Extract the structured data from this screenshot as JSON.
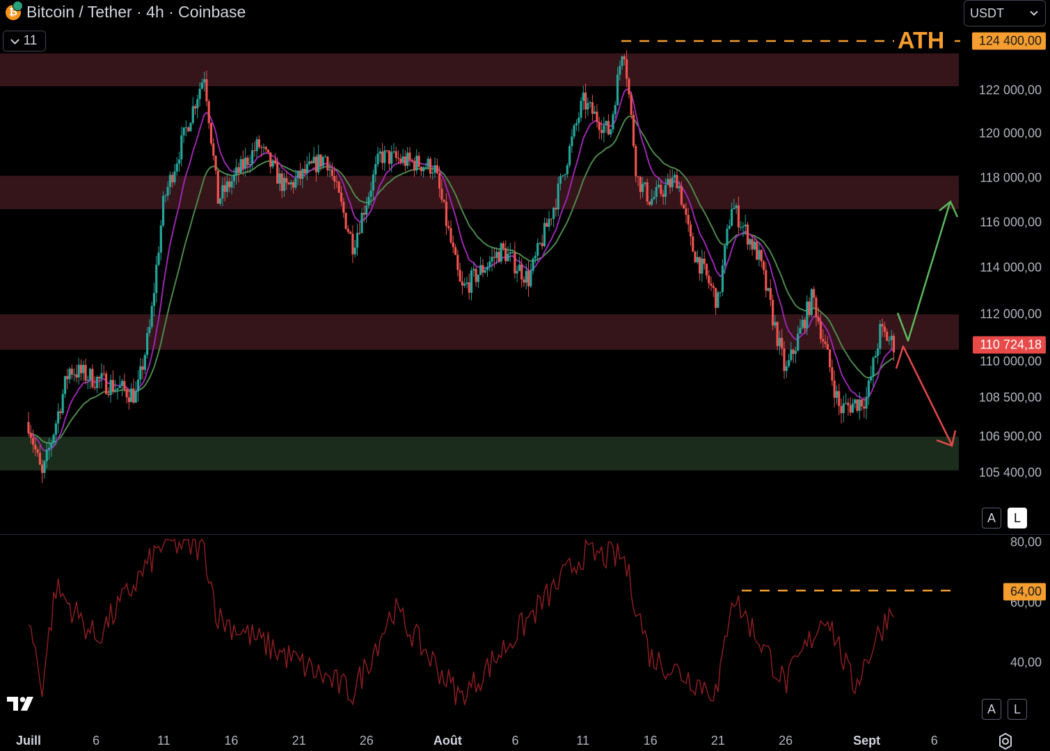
{
  "header": {
    "title": "Bitcoin / Tether · 4h · Coinbase",
    "indicator_count": "11",
    "currency": "USDT"
  },
  "annotations": {
    "ath_label": "ATH",
    "ath_price": "124 400,00",
    "current_price": "110 724,18",
    "rsi_marker": "64,00"
  },
  "price_axis": {
    "labels": [
      "122 000,00",
      "120 000,00",
      "118 000,00",
      "116 000,00",
      "114 000,00",
      "112 000,00",
      "110 000,00",
      "108 500,00",
      "106 900,00",
      "105 400,00"
    ]
  },
  "rsi_axis": {
    "labels": [
      "80,00",
      "60,00",
      "40,00"
    ]
  },
  "time_axis": {
    "labels": [
      "Juill",
      "6",
      "11",
      "16",
      "21",
      "26",
      "Août",
      "6",
      "11",
      "16",
      "21",
      "26",
      "Sept",
      "6"
    ]
  },
  "scale_buttons": {
    "auto": "A",
    "log": "L"
  },
  "colors": {
    "background": "#000000",
    "up_candle": "#26a69a",
    "down_candle": "#ef5350",
    "zone_red": "#35141a",
    "zone_green": "#1b2c1c",
    "ema_fast": "#9c27b0",
    "ema_slow": "#4e8a4e",
    "ath_orange": "#f59d2e",
    "arrow_up": "#5cb85c",
    "arrow_down": "#e84a4a",
    "rsi_line": "#8b1e22"
  },
  "chart_data": {
    "type": "candlestick",
    "title": "Bitcoin / Tether · 4h · Coinbase",
    "y_unit": "USDT",
    "ylim": [
      104500,
      125200
    ],
    "key_points": [
      {
        "x": "Juill 1",
        "price": 107500
      },
      {
        "x": "Juill 2",
        "price": 105200
      },
      {
        "x": "Juill 4",
        "price": 109700
      },
      {
        "x": "Juill 9",
        "price": 108600
      },
      {
        "x": "Juill 10",
        "price": 111500
      },
      {
        "x": "Juill 11",
        "price": 117000
      },
      {
        "x": "Juill 14",
        "price": 122800
      },
      {
        "x": "Juill 15",
        "price": 117000
      },
      {
        "x": "Juill 18",
        "price": 119500
      },
      {
        "x": "Juill 20",
        "price": 117500
      },
      {
        "x": "Juill 23",
        "price": 119000
      },
      {
        "x": "Juill 25",
        "price": 115000
      },
      {
        "x": "Juill 27",
        "price": 119000
      },
      {
        "x": "Juill 31",
        "price": 118500
      },
      {
        "x": "Août 2",
        "price": 113000
      },
      {
        "x": "Août 5",
        "price": 114800
      },
      {
        "x": "Août 7",
        "price": 113500
      },
      {
        "x": "Août 9",
        "price": 117000
      },
      {
        "x": "Août 11",
        "price": 121500
      },
      {
        "x": "Août 13",
        "price": 120000
      },
      {
        "x": "Août 14",
        "price": 124400
      },
      {
        "x": "Août 15",
        "price": 118000
      },
      {
        "x": "Août 16",
        "price": 117000
      },
      {
        "x": "Août 18",
        "price": 118000
      },
      {
        "x": "Août 19",
        "price": 115000
      },
      {
        "x": "Août 21",
        "price": 112500
      },
      {
        "x": "Août 22",
        "price": 116800
      },
      {
        "x": "Août 24",
        "price": 114500
      },
      {
        "x": "Août 26",
        "price": 109500
      },
      {
        "x": "Août 28",
        "price": 112800
      },
      {
        "x": "Août 30",
        "price": 108000
      },
      {
        "x": "Sept 1",
        "price": 108500
      },
      {
        "x": "Sept 2",
        "price": 111300
      },
      {
        "x": "Sept 3",
        "price": 110724
      }
    ],
    "zones": [
      {
        "type": "resistance",
        "from": 122200,
        "to": 123800
      },
      {
        "type": "resistance",
        "from": 116600,
        "to": 118100
      },
      {
        "type": "resistance",
        "from": 110500,
        "to": 112000
      },
      {
        "type": "support",
        "from": 105500,
        "to": 106900
      }
    ],
    "ath": 124400,
    "current": 110724.18,
    "rsi": {
      "ylim": [
        25,
        82
      ],
      "marker": 64,
      "key_points": [
        {
          "x": "Juill 1",
          "value": 55
        },
        {
          "x": "Juill 2",
          "value": 32
        },
        {
          "x": "Juill 3",
          "value": 65
        },
        {
          "x": "Juill 6",
          "value": 48
        },
        {
          "x": "Juill 11",
          "value": 80
        },
        {
          "x": "Juill 14",
          "value": 78
        },
        {
          "x": "Juill 15",
          "value": 55
        },
        {
          "x": "Juill 25",
          "value": 30
        },
        {
          "x": "Juill 28",
          "value": 58
        },
        {
          "x": "Août 2",
          "value": 28
        },
        {
          "x": "Août 11",
          "value": 76
        },
        {
          "x": "Août 14",
          "value": 75
        },
        {
          "x": "Août 16",
          "value": 42
        },
        {
          "x": "Août 21",
          "value": 30
        },
        {
          "x": "Août 22",
          "value": 63
        },
        {
          "x": "Août 26",
          "value": 33
        },
        {
          "x": "Août 29",
          "value": 57
        },
        {
          "x": "Août 31",
          "value": 32
        },
        {
          "x": "Sept 3",
          "value": 60
        }
      ]
    }
  }
}
